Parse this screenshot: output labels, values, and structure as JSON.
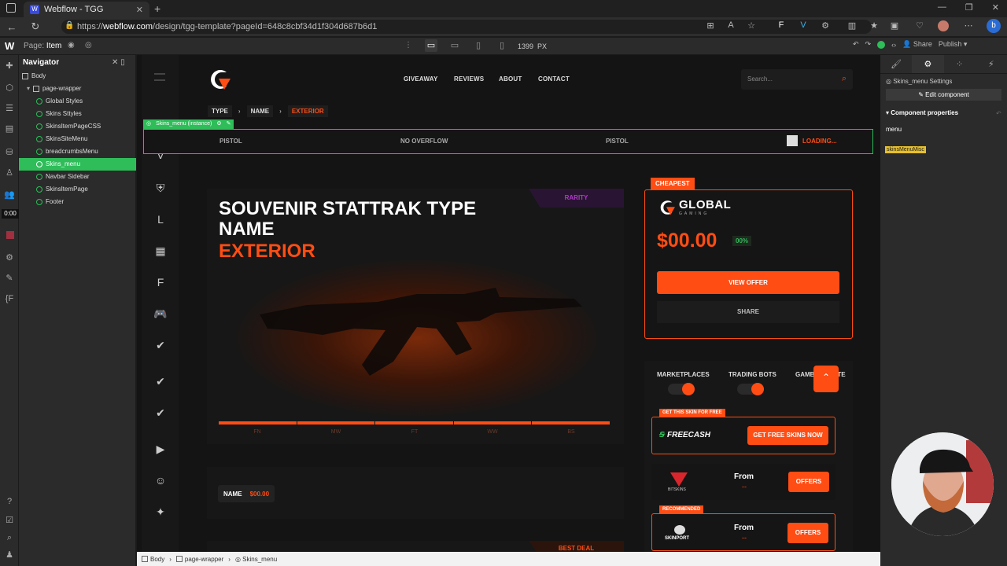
{
  "browser": {
    "tab_title": "Webflow - TGG",
    "tab_favicon": "W",
    "url_prefix": "https://",
    "url_domain": "webflow.com",
    "url_rest": "/design/tgg-template?pageId=648c8cbf34d1f304d687b6d1"
  },
  "designer": {
    "page_label": "Page:",
    "page_name": "Item",
    "width_value": "1399",
    "width_unit": "PX",
    "share_label": "Share",
    "publish_label": "Publish",
    "timer": "0:00"
  },
  "navigator": {
    "title": "Navigator",
    "items": [
      {
        "label": "Body",
        "type": "box"
      },
      {
        "label": "page-wrapper",
        "type": "box"
      },
      {
        "label": "Global Styles",
        "type": "comp"
      },
      {
        "label": "Skins Sttyles",
        "type": "comp"
      },
      {
        "label": "SkinsItemPageCSS",
        "type": "comp"
      },
      {
        "label": "SkinsSiteMenu",
        "type": "comp"
      },
      {
        "label": "breadcrumbsMenu",
        "type": "comp"
      },
      {
        "label": "Skins_menu",
        "type": "comp"
      },
      {
        "label": "Navbar Sidebar",
        "type": "comp"
      },
      {
        "label": "SkinsItemPage",
        "type": "comp"
      },
      {
        "label": "Footer",
        "type": "comp"
      }
    ],
    "selected": "Skins_menu"
  },
  "site": {
    "nav": [
      "GIVEAWAY",
      "REVIEWS",
      "ABOUT",
      "CONTACT"
    ],
    "search_placeholder": "Search...",
    "breadcrumbs": [
      "TYPE",
      "NAME",
      "EXTERIOR"
    ],
    "menu_instance_tag": "Skins_menu (instance)",
    "menu_items": [
      "PISTOL",
      "NO OVERFLOW",
      "PISTOL"
    ],
    "loading_label": "LOADING...",
    "rarity": "RARITY",
    "title_line1": "SOUVENIR STATTRAK TYPE NAME",
    "title_line2": "EXTERIOR",
    "wear_labels": [
      "FN",
      "MW",
      "FT",
      "WW",
      "BS"
    ],
    "name_label": "NAME",
    "name_price": "$00.00",
    "best_deal": "BEST DEAL",
    "cheapest": "CHEAPEST",
    "brand_name": "GLOBAL",
    "brand_sub": "GAMING",
    "offer_price": "$00.00",
    "offer_pct": "00%",
    "view_offer": "VIEW OFFER",
    "share": "SHARE",
    "market_tabs": [
      "MARKETPLACES",
      "TRADING BOTS",
      "GAMBLING SITES"
    ],
    "free_tag": "GET THIS SKIN FOR FREE",
    "freecash_name": "FREECASH",
    "free_btn": "GET FREE SKINS NOW",
    "deals": [
      {
        "name": "BITSKINS",
        "from": "From",
        "price": "--",
        "btn": "OFFERS"
      },
      {
        "name": "SKINPORT",
        "from": "From",
        "price": "--",
        "btn": "OFFERS",
        "tag": "RECOMMENDED"
      }
    ]
  },
  "right_panel": {
    "settings_title": "Skins_menu Settings",
    "edit_component": "Edit component",
    "component_properties": "Component properties",
    "prop_name": "menu",
    "prop_value": "skinsMenuMisc"
  },
  "bottom_bar": [
    "Body",
    "page-wrapper",
    "Skins_menu"
  ],
  "colors": {
    "accent": "#ff4d14",
    "webflow_green": "#2ebd59",
    "background": "#141414"
  }
}
